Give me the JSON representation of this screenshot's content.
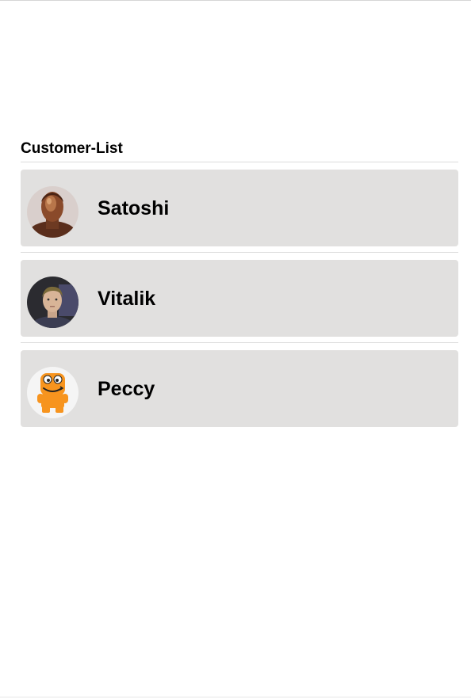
{
  "list": {
    "title": "Customer-List",
    "customers": [
      {
        "name": "Satoshi",
        "avatar": "bronze-bust-avatar"
      },
      {
        "name": "Vitalik",
        "avatar": "person-photo-avatar"
      },
      {
        "name": "Peccy",
        "avatar": "orange-mascot-avatar"
      }
    ]
  },
  "colors": {
    "card_background": "#e1e0df",
    "mascot_orange": "#f7941e"
  }
}
